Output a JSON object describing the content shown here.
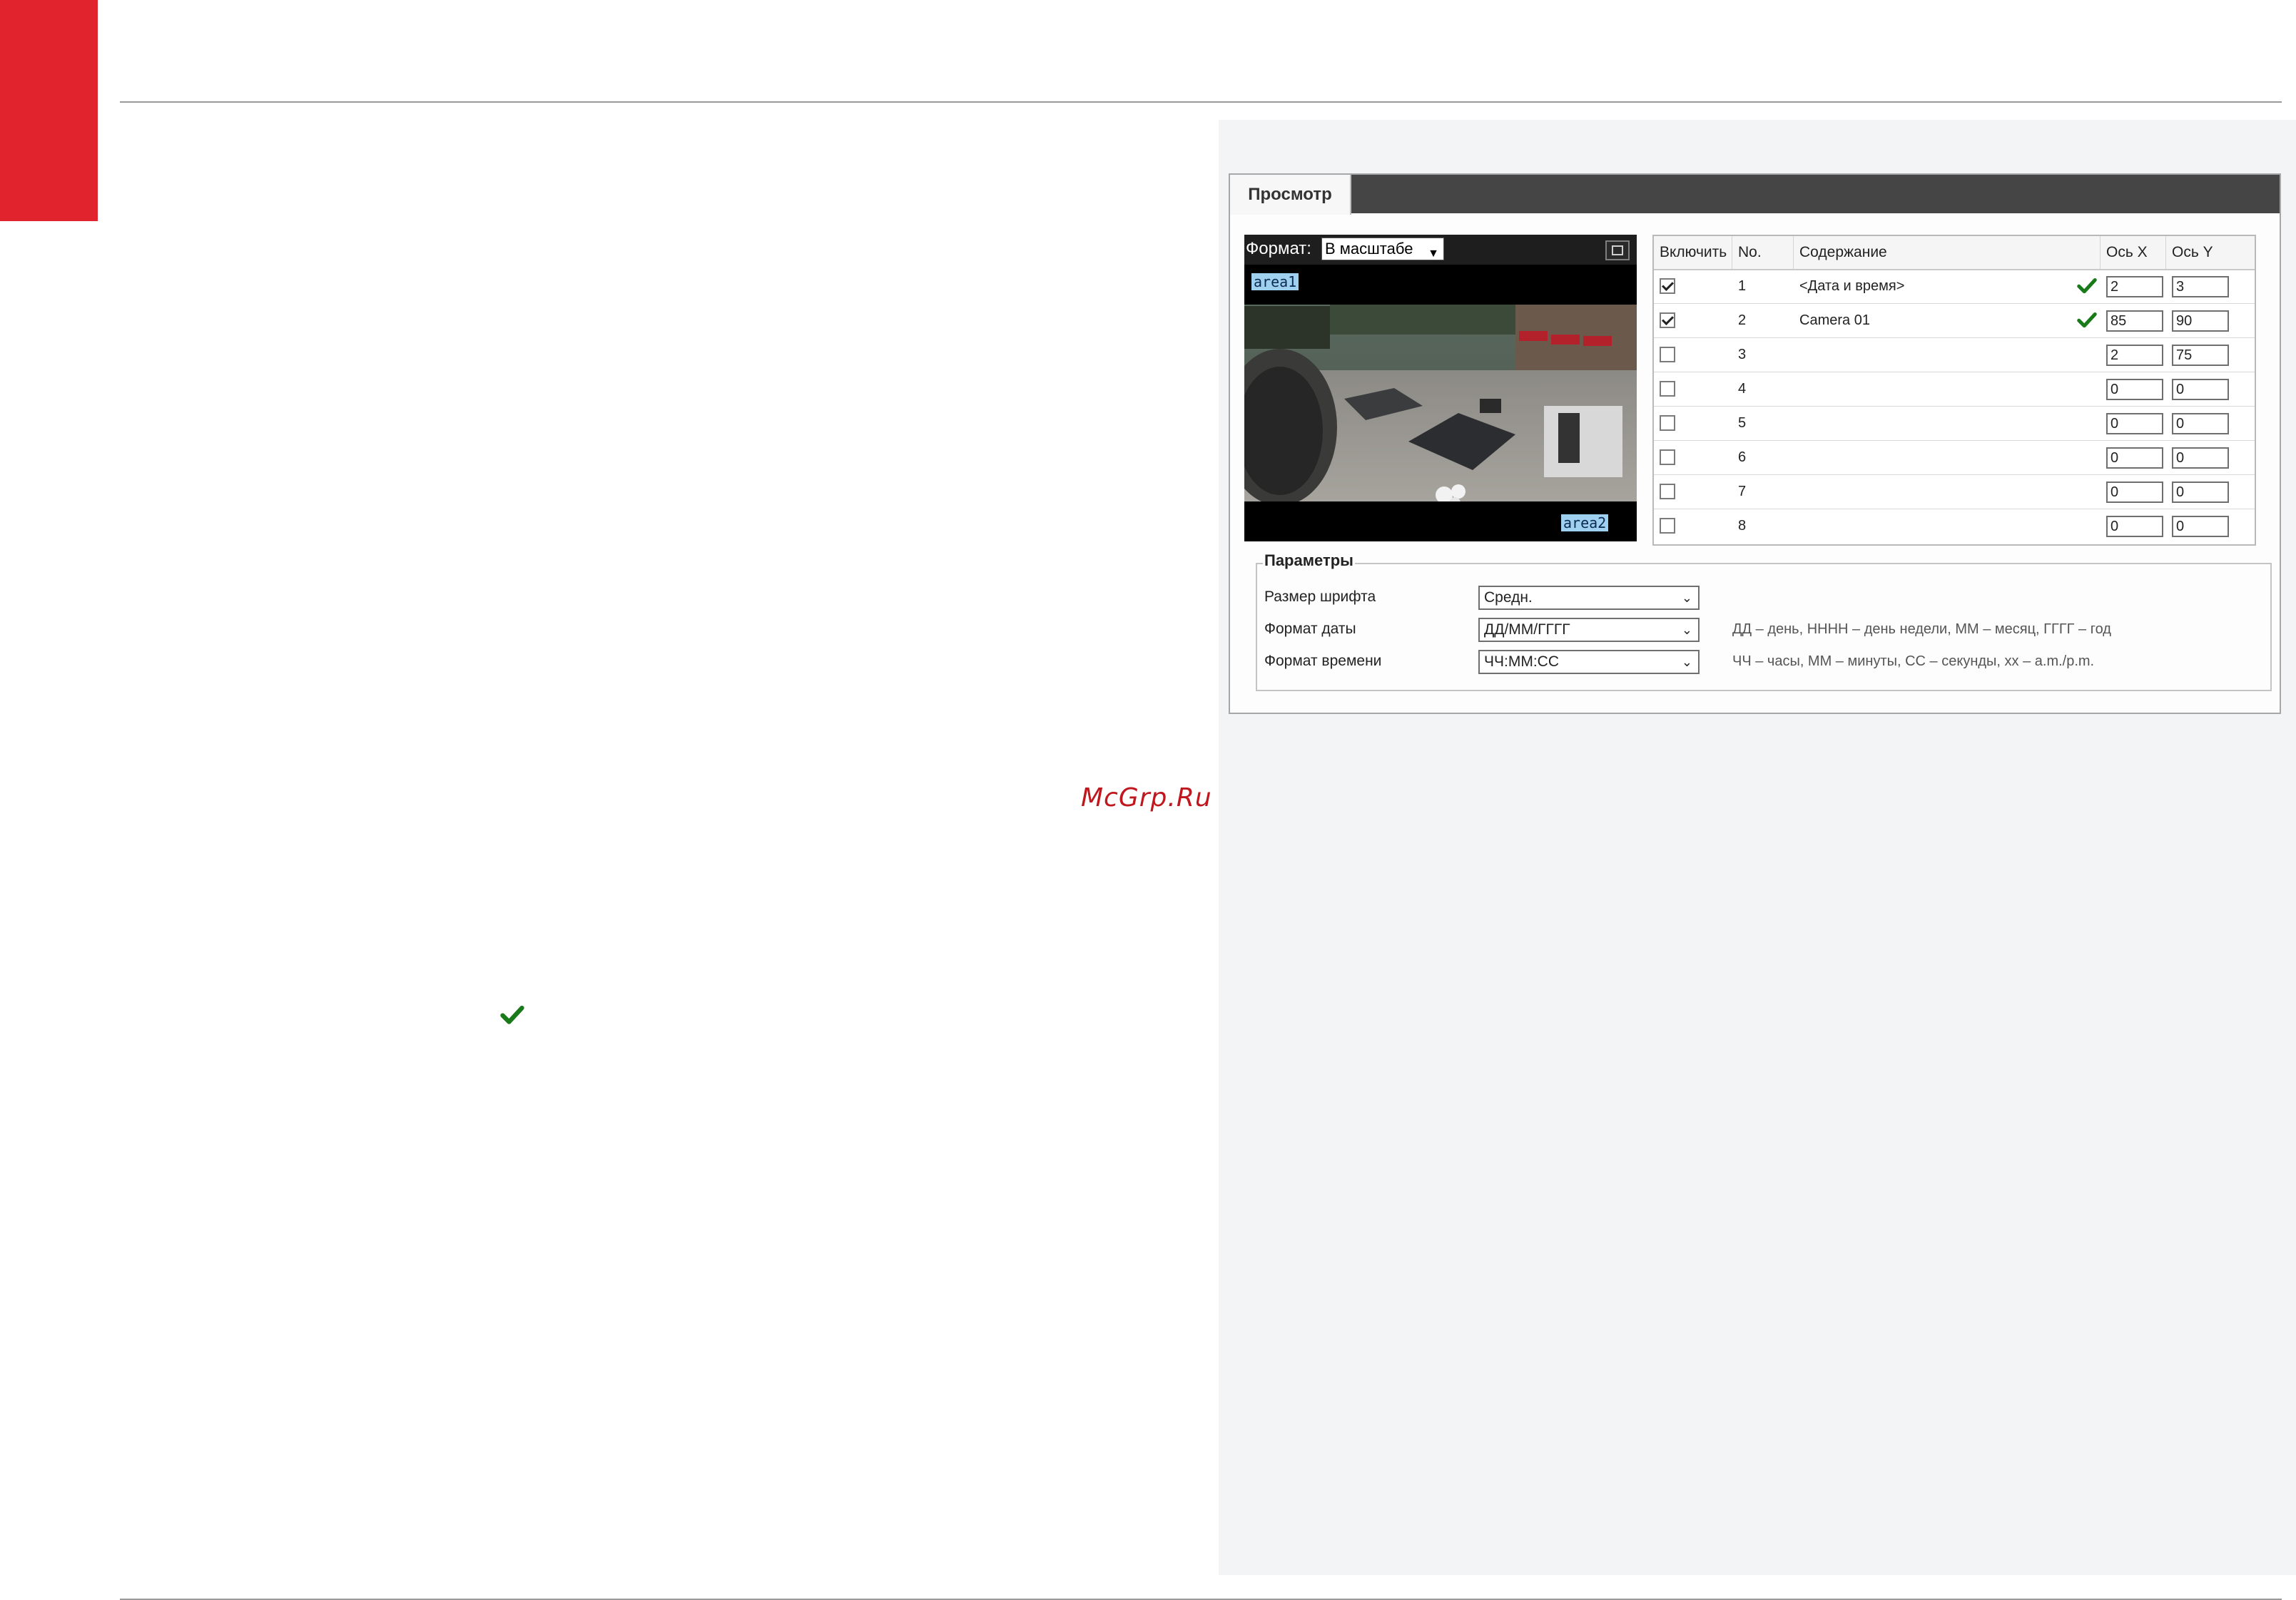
{
  "window": {
    "tab_label": "Просмотр",
    "format_label": "Формат:",
    "format_value": "В масштабе",
    "area_tags": [
      "area1",
      "area2"
    ]
  },
  "table": {
    "headers": [
      "Включить",
      "No.",
      "Содержание",
      "Ось X",
      "Ось Y"
    ],
    "rows": [
      {
        "checked": true,
        "no": "1",
        "content": "<Дата и время>",
        "ok": true,
        "x": "2",
        "y": "3"
      },
      {
        "checked": true,
        "no": "2",
        "content": "Camera 01",
        "ok": true,
        "x": "85",
        "y": "90"
      },
      {
        "checked": false,
        "no": "3",
        "content": "",
        "ok": false,
        "x": "2",
        "y": "75"
      },
      {
        "checked": false,
        "no": "4",
        "content": "",
        "ok": false,
        "x": "0",
        "y": "0"
      },
      {
        "checked": false,
        "no": "5",
        "content": "",
        "ok": false,
        "x": "0",
        "y": "0"
      },
      {
        "checked": false,
        "no": "6",
        "content": "",
        "ok": false,
        "x": "0",
        "y": "0"
      },
      {
        "checked": false,
        "no": "7",
        "content": "",
        "ok": false,
        "x": "0",
        "y": "0"
      },
      {
        "checked": false,
        "no": "8",
        "content": "",
        "ok": false,
        "x": "0",
        "y": "0"
      }
    ]
  },
  "params": {
    "title": "Параметры",
    "font_size_label": "Размер шрифта",
    "font_size_value": "Средн.",
    "date_format_label": "Формат даты",
    "date_format_value": "ДД/ММ/ГГГГ",
    "date_hint": "ДД – день, НННН – день недели, ММ – месяц, ГГГГ – год",
    "time_format_label": "Формат времени",
    "time_format_value": "ЧЧ:ММ:СС",
    "time_hint": "ЧЧ – часы, ММ – минуты, СС – секунды, хх – a.m./p.m."
  },
  "watermark": "McGrp.Ru",
  "colors": {
    "brand_red": "#e1232d",
    "check_green": "#1a7a1a",
    "header_dark": "#454545",
    "panel_gray": "#f2f4f5"
  },
  "icons": {
    "ok": "check-icon",
    "fullscreen": "fullscreen-icon",
    "dropdown": "chevron-down-icon"
  }
}
